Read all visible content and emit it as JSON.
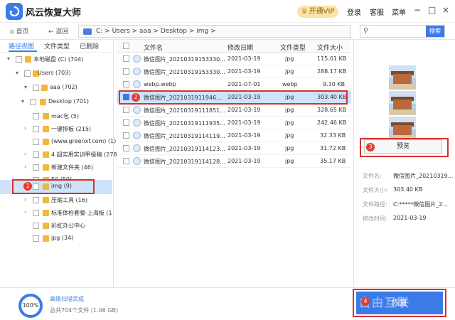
{
  "app": {
    "title": "风云恢复大师",
    "vip_label": "开通VIP",
    "login": "登录",
    "service": "客服",
    "menu": "菜单"
  },
  "nav": {
    "home": "首页",
    "back": "返回",
    "path": "C: > Users > aaa > Desktop > img >",
    "search_placeholder": "",
    "search_button": "搜索"
  },
  "tabs": [
    "路径视图",
    "文件类型",
    "已删除"
  ],
  "tree": [
    {
      "label": "本地磁盘 (C) (704)"
    },
    {
      "label": "Users (703)"
    },
    {
      "label": "aaa (702)"
    },
    {
      "label": "Desktop (701)"
    },
    {
      "label": "mac包 (5)"
    },
    {
      "label": "一键排板 (215)"
    },
    {
      "label": "(www.greenxf.com) (1) ("
    },
    {
      "label": "4 超实用实训甲级稿 (278)"
    },
    {
      "label": "新建文件夹 (46)"
    },
    {
      "label": "50 (50)"
    },
    {
      "label": "img (9)"
    },
    {
      "label": "压缩工具 (16)"
    },
    {
      "label": "标准体检套餐-上海板 (1"
    },
    {
      "label": "彩虹办公中心"
    },
    {
      "label": "jpg (34)"
    }
  ],
  "columns": {
    "name": "文件名",
    "date": "修改日期",
    "type": "文件类型",
    "size": "文件大小"
  },
  "files": [
    {
      "name": "微信图片_20210319153330...",
      "date": "2021-03-19",
      "type": "jpg",
      "size": "115.01 KB"
    },
    {
      "name": "微信图片_20210319153330...",
      "date": "2021-03-19",
      "type": "jpg",
      "size": "288.17 KB"
    },
    {
      "name": "webp.webp",
      "date": "2021-07-01",
      "type": "webp",
      "size": "9.30 KB"
    },
    {
      "name": "微信图片_2021031911946...",
      "date": "2021-03-19",
      "type": "jpg",
      "size": "303.40 KB"
    },
    {
      "name": "微信图片_20210319111851...",
      "date": "2021-03-19",
      "type": "jpg",
      "size": "328.65 KB"
    },
    {
      "name": "微信图片_20210319111935...",
      "date": "2021-03-19",
      "type": "jpg",
      "size": "242.46 KB"
    },
    {
      "name": "微信图片_20210319114119...",
      "date": "2021-03-19",
      "type": "jpg",
      "size": "32.33 KB"
    },
    {
      "name": "微信图片_20210319114123...",
      "date": "2021-03-19",
      "type": "jpg",
      "size": "31.72 KB"
    },
    {
      "name": "微信图片_20210319114128...",
      "date": "2021-03-19",
      "type": "jpg",
      "size": "35.17 KB"
    }
  ],
  "preview": {
    "button": "预览",
    "labels": {
      "name": "文件名:",
      "size": "文件大小:",
      "path": "文件路径:",
      "modified": "修改时间:"
    },
    "values": {
      "name": "微信图片_20210319...",
      "size": "303.40 KB",
      "path": "C:*****微信图片_2...",
      "modified": "2021-03-19"
    }
  },
  "status": {
    "progress": "100%",
    "line1": "高级扫描完成",
    "line2": "总共704个文件 (1.06 GB)"
  },
  "recover_button": "恢复",
  "badges": [
    "1",
    "2",
    "3",
    "4"
  ],
  "watermark": "自由互联",
  "colors": {
    "accent": "#3b7be8",
    "callout": "#d9302c",
    "selection": "#cfe2fb"
  }
}
